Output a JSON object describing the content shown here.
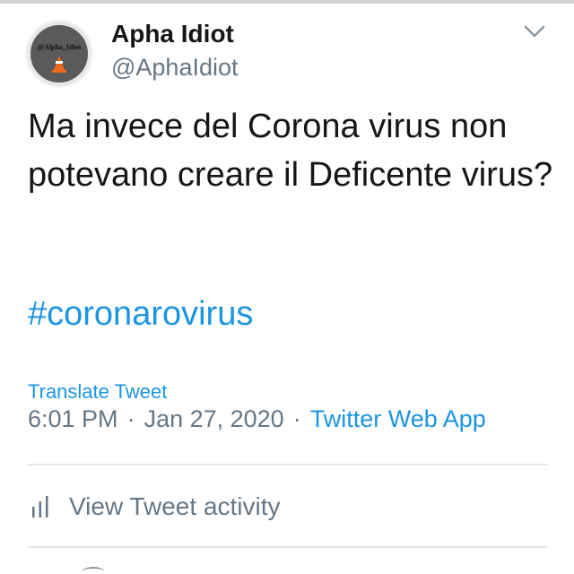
{
  "user": {
    "display_name": "Apha Idiot",
    "handle": "@AphaIdiot",
    "avatar_text": "@Alpha_Idiot"
  },
  "tweet": {
    "text": "Ma invece del Corona virus non potevano creare il Deficente virus?",
    "hashtag": "#coronarovirus"
  },
  "translate_label": "Translate Tweet",
  "meta": {
    "time": "6:01 PM",
    "separator": "·",
    "date": "Jan 27, 2020",
    "source": "Twitter Web App"
  },
  "activity": {
    "label": "View Tweet activity"
  },
  "colors": {
    "accent": "#1b95e0",
    "text": "#141619",
    "secondary": "#657786",
    "divider": "#e3e6e8"
  },
  "icons": {
    "menu": "chevron-down-icon",
    "activity": "bar-chart-icon"
  }
}
